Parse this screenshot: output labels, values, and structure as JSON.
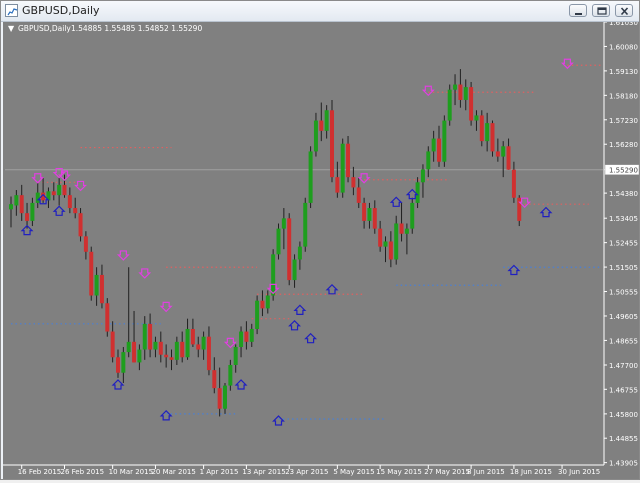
{
  "window": {
    "title": "GBPUSD,Daily"
  },
  "chart_header": {
    "symbol_period": "GBPUSD,Daily",
    "ohlc": "1.54885 1.55485 1.54852 1.55290"
  },
  "colors": {
    "background": "#808080",
    "bull": "#1e9e1e",
    "bear": "#d03030",
    "resistance": "#e06060",
    "support": "#4a7fd4",
    "top_marker": "#e040e0",
    "bottom_marker": "#2020c0",
    "price_line": "#a0a0a0"
  },
  "chart_data": {
    "type": "candlestick",
    "y_range": [
      1.4393,
      1.6103
    ],
    "y_ticks": [
      "1.61030",
      "1.60080",
      "1.59130",
      "1.58180",
      "1.57230",
      "1.56280",
      "1.55290",
      "1.54380",
      "1.53405",
      "1.52455",
      "1.51505",
      "1.50555",
      "1.49605",
      "1.48655",
      "1.47700",
      "1.46755",
      "1.45800",
      "1.44855",
      "1.43905"
    ],
    "x_labels": [
      "16 Feb 2015",
      "26 Feb 2015",
      "10 Mar 2015",
      "20 Mar 2015",
      "1 Apr 2015",
      "13 Apr 2015",
      "23 Apr 2015",
      "5 May 2015",
      "15 May 2015",
      "27 May 2015",
      "8 Jun 2015",
      "18 Jun 2015",
      "30 Jun 2015"
    ],
    "x_label_index": [
      2,
      10,
      19,
      27,
      36,
      44,
      52,
      61,
      69,
      78,
      86,
      94,
      103
    ],
    "current_price": 1.5529,
    "candles": [
      [
        1.5375,
        1.5425,
        1.5305,
        1.5395
      ],
      [
        1.539,
        1.545,
        1.535,
        1.543
      ],
      [
        1.543,
        1.547,
        1.533,
        1.536
      ],
      [
        1.536,
        1.54,
        1.53,
        1.533
      ],
      [
        1.533,
        1.542,
        1.531,
        1.54
      ],
      [
        1.54,
        1.548,
        1.538,
        1.544
      ],
      [
        1.544,
        1.55,
        1.54,
        1.541
      ],
      [
        1.541,
        1.546,
        1.538,
        1.5445
      ],
      [
        1.5445,
        1.548,
        1.541,
        1.543
      ],
      [
        1.543,
        1.55,
        1.539,
        1.547
      ],
      [
        1.547,
        1.551,
        1.542,
        1.543
      ],
      [
        1.543,
        1.546,
        1.536,
        1.538
      ],
      [
        1.538,
        1.542,
        1.534,
        1.536
      ],
      [
        1.536,
        1.538,
        1.525,
        1.527
      ],
      [
        1.527,
        1.529,
        1.518,
        1.521
      ],
      [
        1.521,
        1.523,
        1.502,
        1.504
      ],
      [
        1.504,
        1.515,
        1.5,
        1.512
      ],
      [
        1.512,
        1.516,
        1.499,
        1.501
      ],
      [
        1.501,
        1.503,
        1.488,
        1.49
      ],
      [
        1.49,
        1.494,
        1.478,
        1.48
      ],
      [
        1.48,
        1.483,
        1.472,
        1.474
      ],
      [
        1.474,
        1.484,
        1.47,
        1.482
      ],
      [
        1.482,
        1.515,
        1.48,
        1.486
      ],
      [
        1.486,
        1.498,
        1.478,
        1.478
      ],
      [
        1.478,
        1.485,
        1.475,
        1.483
      ],
      [
        1.483,
        1.496,
        1.479,
        1.493
      ],
      [
        1.493,
        1.497,
        1.48,
        1.483
      ],
      [
        1.483,
        1.488,
        1.48,
        1.486
      ],
      [
        1.486,
        1.49,
        1.478,
        1.481
      ],
      [
        1.481,
        1.485,
        1.476,
        1.48
      ],
      [
        1.48,
        1.483,
        1.475,
        1.479
      ],
      [
        1.479,
        1.488,
        1.477,
        1.486
      ],
      [
        1.486,
        1.49,
        1.478,
        1.48
      ],
      [
        1.48,
        1.495,
        1.479,
        1.491
      ],
      [
        1.491,
        1.495,
        1.484,
        1.485
      ],
      [
        1.485,
        1.488,
        1.48,
        1.483
      ],
      [
        1.483,
        1.49,
        1.479,
        1.488
      ],
      [
        1.488,
        1.492,
        1.473,
        1.475
      ],
      [
        1.475,
        1.48,
        1.466,
        1.468
      ],
      [
        1.468,
        1.476,
        1.457,
        1.46
      ],
      [
        1.46,
        1.47,
        1.458,
        1.469
      ],
      [
        1.469,
        1.479,
        1.467,
        1.477
      ],
      [
        1.477,
        1.485,
        1.474,
        1.484
      ],
      [
        1.484,
        1.492,
        1.48,
        1.49
      ],
      [
        1.49,
        1.494,
        1.483,
        1.486
      ],
      [
        1.486,
        1.493,
        1.484,
        1.491
      ],
      [
        1.491,
        1.504,
        1.489,
        1.502
      ],
      [
        1.502,
        1.506,
        1.496,
        1.499
      ],
      [
        1.499,
        1.506,
        1.497,
        1.504
      ],
      [
        1.504,
        1.522,
        1.502,
        1.52
      ],
      [
        1.52,
        1.532,
        1.518,
        1.53
      ],
      [
        1.53,
        1.538,
        1.522,
        1.534
      ],
      [
        1.534,
        1.536,
        1.508,
        1.51
      ],
      [
        1.51,
        1.52,
        1.507,
        1.518
      ],
      [
        1.518,
        1.525,
        1.514,
        1.523
      ],
      [
        1.523,
        1.542,
        1.521,
        1.54
      ],
      [
        1.54,
        1.562,
        1.538,
        1.56
      ],
      [
        1.56,
        1.575,
        1.558,
        1.572
      ],
      [
        1.572,
        1.579,
        1.564,
        1.568
      ],
      [
        1.568,
        1.578,
        1.565,
        1.576
      ],
      [
        1.576,
        1.58,
        1.548,
        1.55
      ],
      [
        1.55,
        1.556,
        1.542,
        1.544
      ],
      [
        1.544,
        1.565,
        1.542,
        1.563
      ],
      [
        1.563,
        1.566,
        1.548,
        1.55
      ],
      [
        1.55,
        1.554,
        1.543,
        1.546
      ],
      [
        1.546,
        1.55,
        1.538,
        1.54
      ],
      [
        1.54,
        1.542,
        1.53,
        1.533
      ],
      [
        1.533,
        1.54,
        1.53,
        1.538
      ],
      [
        1.538,
        1.541,
        1.528,
        1.53
      ],
      [
        1.53,
        1.533,
        1.521,
        1.523
      ],
      [
        1.523,
        1.527,
        1.517,
        1.525
      ],
      [
        1.525,
        1.529,
        1.515,
        1.518
      ],
      [
        1.518,
        1.535,
        1.516,
        1.532
      ],
      [
        1.532,
        1.54,
        1.525,
        1.528
      ],
      [
        1.528,
        1.532,
        1.52,
        1.53
      ],
      [
        1.53,
        1.542,
        1.528,
        1.54
      ],
      [
        1.54,
        1.55,
        1.538,
        1.548
      ],
      [
        1.548,
        1.555,
        1.542,
        1.553
      ],
      [
        1.553,
        1.562,
        1.55,
        1.56
      ],
      [
        1.56,
        1.568,
        1.556,
        1.565
      ],
      [
        1.565,
        1.57,
        1.554,
        1.556
      ],
      [
        1.556,
        1.574,
        1.554,
        1.572
      ],
      [
        1.572,
        1.586,
        1.57,
        1.584
      ],
      [
        1.584,
        1.59,
        1.578,
        1.586
      ],
      [
        1.586,
        1.592,
        1.577,
        1.58
      ],
      [
        1.58,
        1.588,
        1.576,
        1.585
      ],
      [
        1.585,
        1.587,
        1.57,
        1.572
      ],
      [
        1.572,
        1.576,
        1.568,
        1.574
      ],
      [
        1.574,
        1.576,
        1.562,
        1.564
      ],
      [
        1.564,
        1.575,
        1.56,
        1.571
      ],
      [
        1.571,
        1.572,
        1.558,
        1.56
      ],
      [
        1.56,
        1.565,
        1.556,
        1.558
      ],
      [
        1.558,
        1.564,
        1.55,
        1.562
      ],
      [
        1.562,
        1.565,
        1.5529,
        1.5529
      ],
      [
        1.5529,
        1.556,
        1.54,
        1.542
      ],
      [
        1.542,
        1.543,
        1.531,
        1.533
      ]
    ],
    "top_markers": [
      [
        9,
        1.551
      ],
      [
        13,
        1.546
      ],
      [
        21,
        1.519
      ],
      [
        25,
        1.512
      ],
      [
        29,
        1.499
      ],
      [
        41,
        1.485
      ],
      [
        49,
        1.506
      ],
      [
        66,
        1.549
      ],
      [
        78,
        1.583
      ],
      [
        104,
        1.5935
      ],
      [
        96,
        1.5395
      ],
      [
        10,
        1.55
      ],
      [
        5,
        1.549
      ]
    ],
    "bottom_markers": [
      [
        3,
        1.53
      ],
      [
        6,
        1.542
      ],
      [
        9,
        1.5375
      ],
      [
        20,
        1.47
      ],
      [
        29,
        1.458
      ],
      [
        43,
        1.47
      ],
      [
        50,
        1.456
      ],
      [
        54,
        1.499
      ],
      [
        56,
        1.488
      ],
      [
        60,
        1.507
      ],
      [
        72,
        1.541
      ],
      [
        75,
        1.544
      ],
      [
        94,
        1.5145
      ],
      [
        100,
        1.537
      ],
      [
        53,
        1.493
      ]
    ],
    "resistance_lines": [
      [
        13,
        30,
        1.5615
      ],
      [
        29,
        46,
        1.515
      ],
      [
        46,
        66,
        1.5045
      ],
      [
        66,
        82,
        1.549
      ],
      [
        78,
        98,
        1.583
      ],
      [
        96,
        108,
        1.5395
      ],
      [
        104,
        118,
        1.5935
      ],
      [
        5,
        12,
        1.548
      ],
      [
        45,
        52,
        1.495
      ]
    ],
    "support_lines": [
      [
        0,
        28,
        1.493
      ],
      [
        29,
        42,
        1.458
      ],
      [
        50,
        70,
        1.456
      ],
      [
        72,
        92,
        1.508
      ],
      [
        92,
        118,
        1.515
      ]
    ]
  }
}
